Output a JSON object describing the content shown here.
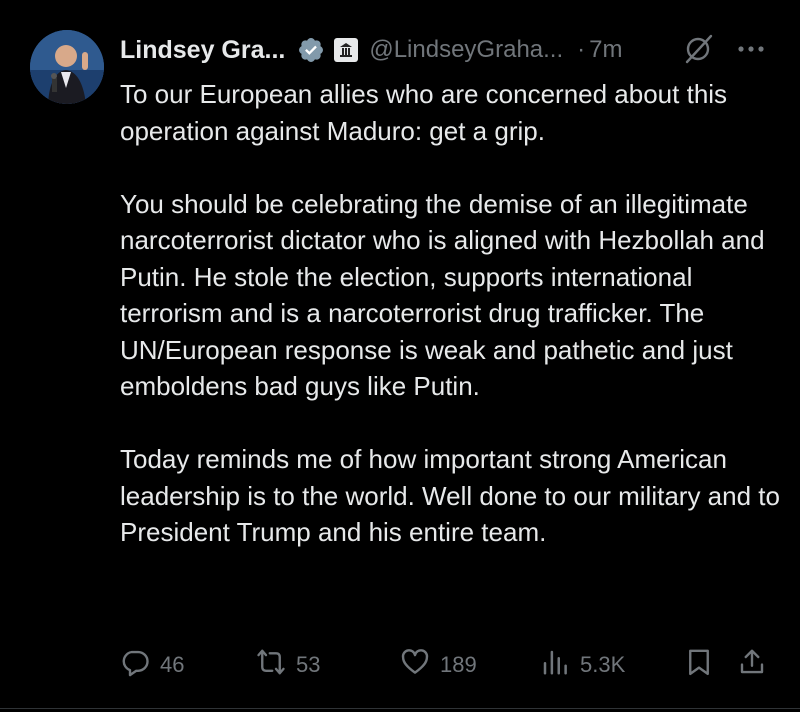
{
  "author": {
    "name": "Lindsey Gra...",
    "handle": "@LindseyGraha...",
    "separator": "·",
    "time": "7m"
  },
  "icons": {
    "verified": "verified-badge-icon",
    "government": "government-building-icon",
    "grok": "grok-icon",
    "more": "more-icon",
    "reply": "reply-icon",
    "repost": "repost-icon",
    "like": "like-icon",
    "views": "views-icon",
    "bookmark": "bookmark-icon",
    "share": "share-icon"
  },
  "colors": {
    "background": "#000000",
    "text": "#e7e9ea",
    "secondary": "#71767b",
    "verified": "#829aab"
  },
  "tweet": {
    "paragraphs": [
      "To our European allies who are concerned about this operation against Maduro: get a grip.",
      "You should be celebrating the demise of an illegitimate narcoterrorist dictator who is aligned with Hezbollah and Putin. He stole the election, supports international terrorism and is a narcoterrorist drug trafficker. The UN/European response is weak and pathetic and just emboldens bad guys like Putin.",
      "Today reminds me of how important strong American leadership is to the world. Well done to our military and to President Trump and his entire team."
    ]
  },
  "metrics": {
    "replies": "46",
    "reposts": "53",
    "likes": "189",
    "views": "5.3K"
  }
}
